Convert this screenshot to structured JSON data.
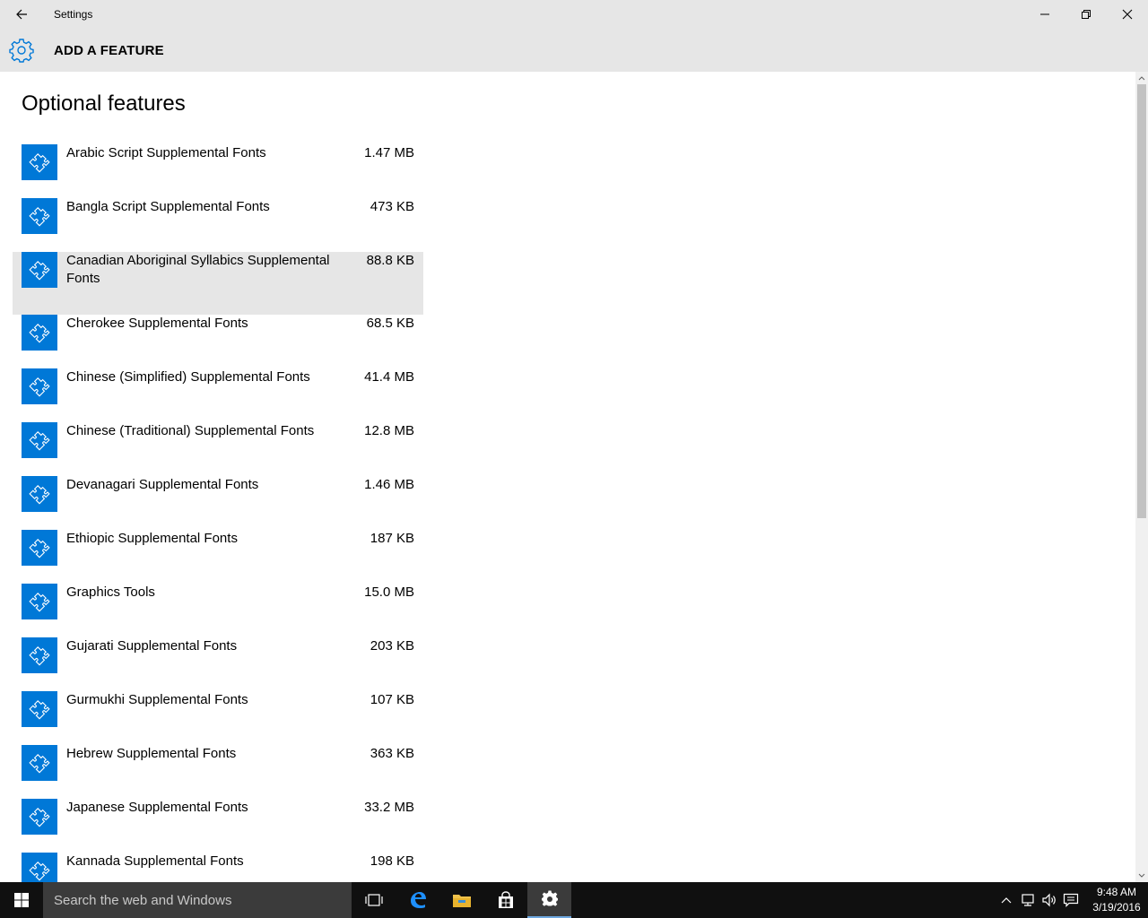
{
  "window": {
    "title": "Settings"
  },
  "header": {
    "title": "ADD A FEATURE"
  },
  "page": {
    "title": "Optional features"
  },
  "features": [
    {
      "name": "Arabic Script Supplemental Fonts",
      "size": "1.47 MB"
    },
    {
      "name": "Bangla Script Supplemental Fonts",
      "size": "473 KB"
    },
    {
      "name": "Canadian Aboriginal Syllabics Supplemental Fonts",
      "size": "88.8 KB"
    },
    {
      "name": "Cherokee Supplemental Fonts",
      "size": "68.5 KB"
    },
    {
      "name": "Chinese (Simplified) Supplemental Fonts",
      "size": "41.4 MB"
    },
    {
      "name": "Chinese (Traditional) Supplemental Fonts",
      "size": "12.8 MB"
    },
    {
      "name": "Devanagari Supplemental Fonts",
      "size": "1.46 MB"
    },
    {
      "name": "Ethiopic Supplemental Fonts",
      "size": "187 KB"
    },
    {
      "name": "Graphics Tools",
      "size": "15.0 MB"
    },
    {
      "name": "Gujarati Supplemental Fonts",
      "size": "203 KB"
    },
    {
      "name": "Gurmukhi Supplemental Fonts",
      "size": "107 KB"
    },
    {
      "name": "Hebrew Supplemental Fonts",
      "size": "363 KB"
    },
    {
      "name": "Japanese Supplemental Fonts",
      "size": "33.2 MB"
    },
    {
      "name": "Kannada Supplemental Fonts",
      "size": "198 KB"
    }
  ],
  "taskbar": {
    "search_placeholder": "Search the web and Windows",
    "time": "9:48 AM",
    "date": "3/19/2016"
  },
  "colors": {
    "accent": "#0078d7",
    "chrome": "#e6e6e6",
    "taskbar": "#101010"
  }
}
